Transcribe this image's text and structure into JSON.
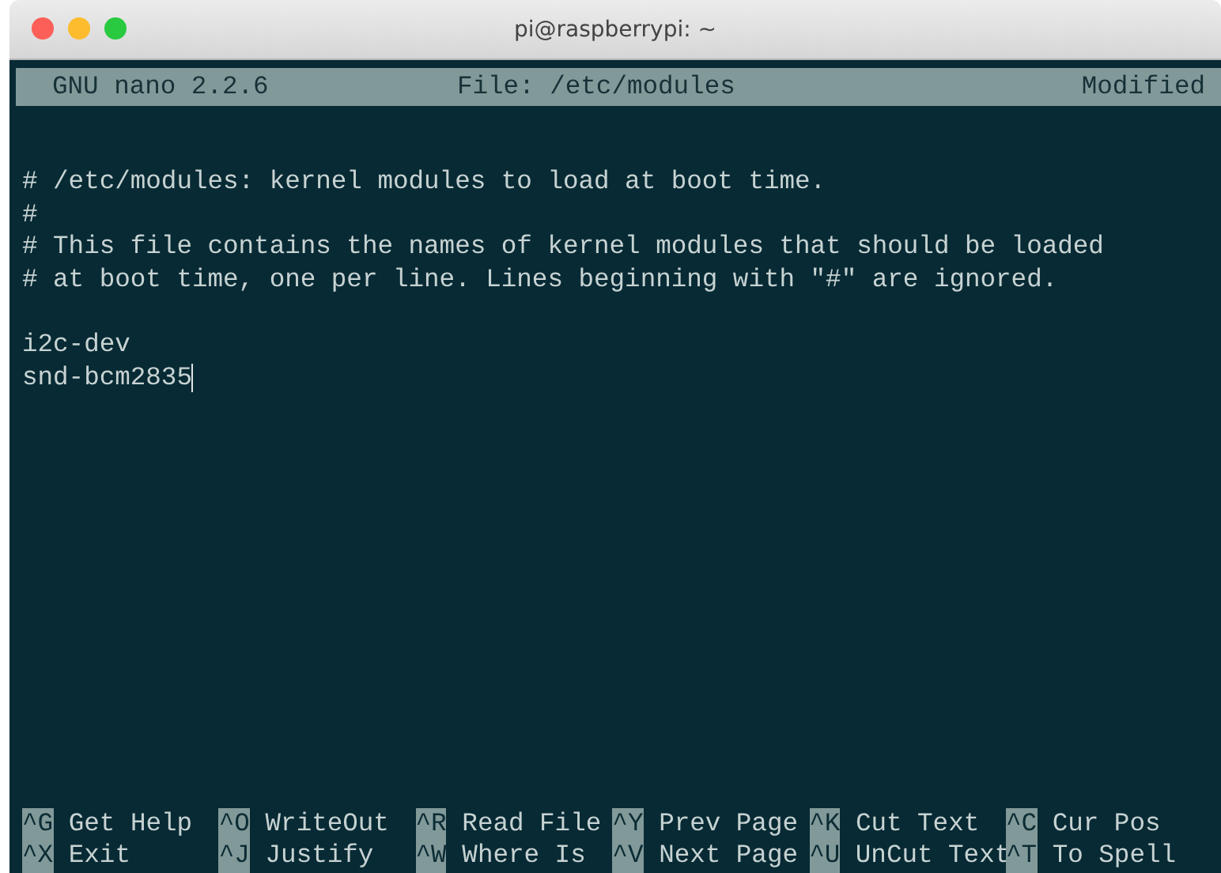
{
  "window": {
    "title": "pi@raspberrypi: ~"
  },
  "header": {
    "version": "GNU nano 2.2.6",
    "file": "File: /etc/modules",
    "status": "Modified"
  },
  "blocks": [
    [
      {
        "text": "# /etc/modules: kernel modules to load at boot time.",
        "cursor": false
      },
      {
        "text": "#",
        "cursor": false
      },
      {
        "text": "# This file contains the names of kernel modules that should be loaded",
        "cursor": false
      },
      {
        "text": "# at boot time, one per line. Lines beginning with \"#\" are ignored.",
        "cursor": false
      }
    ],
    [
      {
        "text": "i2c-dev",
        "cursor": false
      },
      {
        "text": "snd-bcm2835",
        "cursor": true
      }
    ]
  ],
  "shortcuts": [
    [
      {
        "key": "^G",
        "label": "Get Help"
      },
      {
        "key": "^O",
        "label": "WriteOut"
      },
      {
        "key": "^R",
        "label": "Read File"
      },
      {
        "key": "^Y",
        "label": "Prev Page"
      },
      {
        "key": "^K",
        "label": "Cut Text"
      },
      {
        "key": "^C",
        "label": "Cur Pos"
      }
    ],
    [
      {
        "key": "^X",
        "label": "Exit"
      },
      {
        "key": "^J",
        "label": "Justify"
      },
      {
        "key": "^W",
        "label": "Where Is"
      },
      {
        "key": "^V",
        "label": "Next Page"
      },
      {
        "key": "^U",
        "label": "UnCut Text"
      },
      {
        "key": "^T",
        "label": "To Spell"
      }
    ]
  ]
}
